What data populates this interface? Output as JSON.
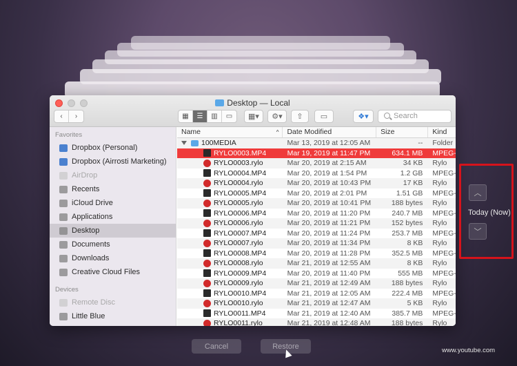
{
  "window": {
    "title": "Desktop — Local",
    "search_placeholder": "Search"
  },
  "toolbar": {
    "back_icon": "chevron-left-icon",
    "forward_icon": "chevron-right-icon",
    "view_modes": [
      "icon-view-icon",
      "list-view-icon",
      "column-view-icon",
      "gallery-view-icon"
    ],
    "active_view": "list-view-icon"
  },
  "sidebar": {
    "favorites_label": "Favorites",
    "favorites": [
      {
        "label": "Dropbox (Personal)",
        "icon": "dropbox-icon",
        "dim": false
      },
      {
        "label": "Dropbox (Airrosti Marketing)",
        "icon": "dropbox-icon",
        "dim": false
      },
      {
        "label": "AirDrop",
        "icon": "airdrop-icon",
        "dim": true
      },
      {
        "label": "Recents",
        "icon": "recents-icon",
        "dim": false
      },
      {
        "label": "iCloud Drive",
        "icon": "cloud-icon",
        "dim": false
      },
      {
        "label": "Applications",
        "icon": "applications-icon",
        "dim": false
      },
      {
        "label": "Desktop",
        "icon": "desktop-icon",
        "dim": false,
        "selected": true
      },
      {
        "label": "Documents",
        "icon": "documents-icon",
        "dim": false
      },
      {
        "label": "Downloads",
        "icon": "downloads-icon",
        "dim": false
      },
      {
        "label": "Creative Cloud Files",
        "icon": "creative-cloud-icon",
        "dim": false
      }
    ],
    "devices_label": "Devices",
    "devices": [
      {
        "label": "Remote Disc",
        "icon": "disc-icon",
        "dim": true
      },
      {
        "label": "Little Blue",
        "icon": "drive-icon",
        "dim": false
      }
    ]
  },
  "columns": {
    "name": "Name",
    "date": "Date Modified",
    "size": "Size",
    "kind": "Kind"
  },
  "files": [
    {
      "name": "100MEDIA",
      "date": "Mar 13, 2019 at 12:05 AM",
      "size": "--",
      "kind": "Folder",
      "type": "folder"
    },
    {
      "name": "RYLO0003.MP4",
      "date": "Mar 19, 2019 at 11:47 PM",
      "size": "634.1 MB",
      "kind": "MPEG-",
      "type": "mp4",
      "selected": true
    },
    {
      "name": "RYLO0003.rylo",
      "date": "Mar 20, 2019 at 2:15 AM",
      "size": "34 KB",
      "kind": "Rylo",
      "type": "rylo"
    },
    {
      "name": "RYLO0004.MP4",
      "date": "Mar 20, 2019 at 1:54 PM",
      "size": "1.2 GB",
      "kind": "MPEG-",
      "type": "mp4"
    },
    {
      "name": "RYLO0004.rylo",
      "date": "Mar 20, 2019 at 10:43 PM",
      "size": "17 KB",
      "kind": "Rylo",
      "type": "rylo"
    },
    {
      "name": "RYLO0005.MP4",
      "date": "Mar 20, 2019 at 2:01 PM",
      "size": "1.51 GB",
      "kind": "MPEG-",
      "type": "mp4"
    },
    {
      "name": "RYLO0005.rylo",
      "date": "Mar 20, 2019 at 10:41 PM",
      "size": "188 bytes",
      "kind": "Rylo",
      "type": "rylo"
    },
    {
      "name": "RYLO0006.MP4",
      "date": "Mar 20, 2019 at 11:20 PM",
      "size": "240.7 MB",
      "kind": "MPEG-",
      "type": "mp4"
    },
    {
      "name": "RYLO0006.rylo",
      "date": "Mar 20, 2019 at 11:21 PM",
      "size": "152 bytes",
      "kind": "Rylo",
      "type": "rylo"
    },
    {
      "name": "RYLO0007.MP4",
      "date": "Mar 20, 2019 at 11:24 PM",
      "size": "253.7 MB",
      "kind": "MPEG-",
      "type": "mp4"
    },
    {
      "name": "RYLO0007.rylo",
      "date": "Mar 20, 2019 at 11:34 PM",
      "size": "8 KB",
      "kind": "Rylo",
      "type": "rylo"
    },
    {
      "name": "RYLO0008.MP4",
      "date": "Mar 20, 2019 at 11:28 PM",
      "size": "352.5 MB",
      "kind": "MPEG-",
      "type": "mp4"
    },
    {
      "name": "RYLO0008.rylo",
      "date": "Mar 21, 2019 at 12:55 AM",
      "size": "8 KB",
      "kind": "Rylo",
      "type": "rylo"
    },
    {
      "name": "RYLO0009.MP4",
      "date": "Mar 20, 2019 at 11:40 PM",
      "size": "555 MB",
      "kind": "MPEG-",
      "type": "mp4"
    },
    {
      "name": "RYLO0009.rylo",
      "date": "Mar 21, 2019 at 12:49 AM",
      "size": "188 bytes",
      "kind": "Rylo",
      "type": "rylo"
    },
    {
      "name": "RYLO0010.MP4",
      "date": "Mar 21, 2019 at 12:05 AM",
      "size": "222.4 MB",
      "kind": "MPEG-",
      "type": "mp4"
    },
    {
      "name": "RYLO0010.rylo",
      "date": "Mar 21, 2019 at 12:47 AM",
      "size": "5 KB",
      "kind": "Rylo",
      "type": "rylo"
    },
    {
      "name": "RYLO0011.MP4",
      "date": "Mar 21, 2019 at 12:40 AM",
      "size": "385.7 MB",
      "kind": "MPEG-",
      "type": "mp4"
    },
    {
      "name": "RYLO0011.rylo",
      "date": "Mar 21, 2019 at 12:48 AM",
      "size": "188 bytes",
      "kind": "Rylo",
      "type": "rylo"
    }
  ],
  "time_machine": {
    "label": "Today (Now)",
    "up_icon": "chevron-up-icon",
    "down_icon": "chevron-down-icon"
  },
  "buttons": {
    "cancel": "Cancel",
    "restore": "Restore"
  },
  "watermark": "www.youtube.com"
}
